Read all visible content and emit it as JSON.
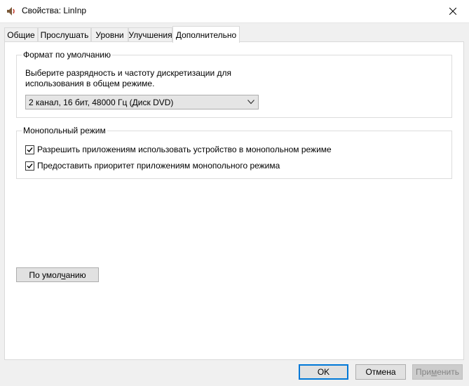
{
  "window": {
    "title": "Свойства: LinInp",
    "close_symbol": "✕"
  },
  "tabs": [
    {
      "label": "Общие"
    },
    {
      "label": "Прослушать"
    },
    {
      "label": "Уровни"
    },
    {
      "label": "Улучшения"
    },
    {
      "label": "Дополнительно",
      "active": true
    }
  ],
  "default_format": {
    "group_title": "Формат по умолчанию",
    "description_line1": "Выберите разрядность и частоту дискретизации для",
    "description_line2": "использования в общем режиме.",
    "selected_format": "2 канал, 16 бит, 48000 Гц (Диск DVD)"
  },
  "exclusive_mode": {
    "group_title": "Монопольный режим",
    "allow_exclusive_label": "Разрешить приложениям использовать устройство в монопольном режиме",
    "allow_exclusive_checked": true,
    "priority_label": "Предоставить приоритет приложениям монопольного режима",
    "priority_checked": true
  },
  "restore_defaults": {
    "label_prefix": "По умол",
    "label_mnemonic": "ч",
    "label_suffix": "анию"
  },
  "footer": {
    "ok_label": "OK",
    "cancel_label": "Отмена",
    "apply_prefix": "При",
    "apply_mnemonic": "м",
    "apply_suffix": "енить"
  },
  "colors": {
    "focus_border": "#0078d7",
    "window_bg": "#f0f0f0"
  },
  "icons": {
    "title": "speaker-icon",
    "close": "close-icon",
    "combo": "chevron-down-icon",
    "checkbox": "checkmark-icon"
  }
}
